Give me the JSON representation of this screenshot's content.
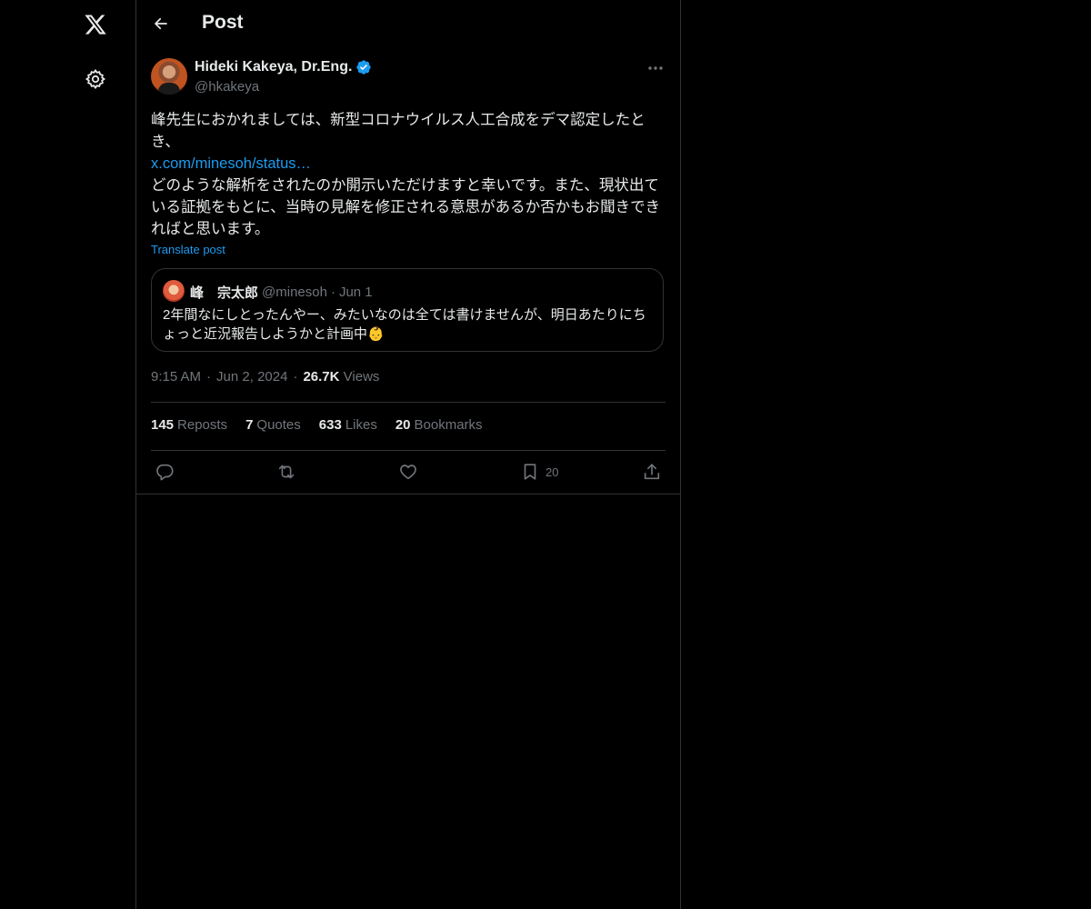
{
  "header": {
    "title": "Post",
    "back_icon": "arrow-left-icon"
  },
  "nav": {
    "logo_icon": "x-logo-icon",
    "settings_icon": "gear-icon"
  },
  "author": {
    "display_name": "Hideki Kakeya, Dr.Eng.",
    "handle": "@hkakeya",
    "verified": true,
    "verified_color": "#1d9bf0"
  },
  "tweet": {
    "line1": "峰先生におかれましては、新型コロナウイルス人工合成をデマ認定したとき、",
    "link": "x.com/minesoh/status…",
    "line2": "どのような解析をされたのか開示いただけますと幸いです。また、現状出ている証拠をもとに、当時の見解を修正される意思があるか否かもお聞きできればと思います。",
    "translate": "Translate post"
  },
  "quote": {
    "name": "峰　宗太郎",
    "handle": "@minesoh",
    "separator": "·",
    "date": "Jun 1",
    "text": "2年間なにしとったんやー、みたいなのは全ては書けませんが、明日あたりにちょっと近況報告しようかと計画中👶"
  },
  "meta": {
    "time": "9:15 AM",
    "separator": "·",
    "date": "Jun 2, 2024",
    "views_count": "26.7K",
    "views_label": "Views"
  },
  "stats": {
    "reposts_count": "145",
    "reposts_label": "Reposts",
    "quotes_count": "7",
    "quotes_label": "Quotes",
    "likes_count": "633",
    "likes_label": "Likes",
    "bookmarks_count": "20",
    "bookmarks_label": "Bookmarks"
  },
  "actions": {
    "reply_icon": "reply-icon",
    "repost_icon": "repost-icon",
    "like_icon": "heart-icon",
    "bookmark_icon": "bookmark-icon",
    "bookmark_count": "20",
    "share_icon": "share-icon"
  },
  "colors": {
    "background": "#000000",
    "text": "#e7e9ea",
    "muted": "#71767b",
    "accent": "#1d9bf0",
    "border": "#2f3336"
  }
}
